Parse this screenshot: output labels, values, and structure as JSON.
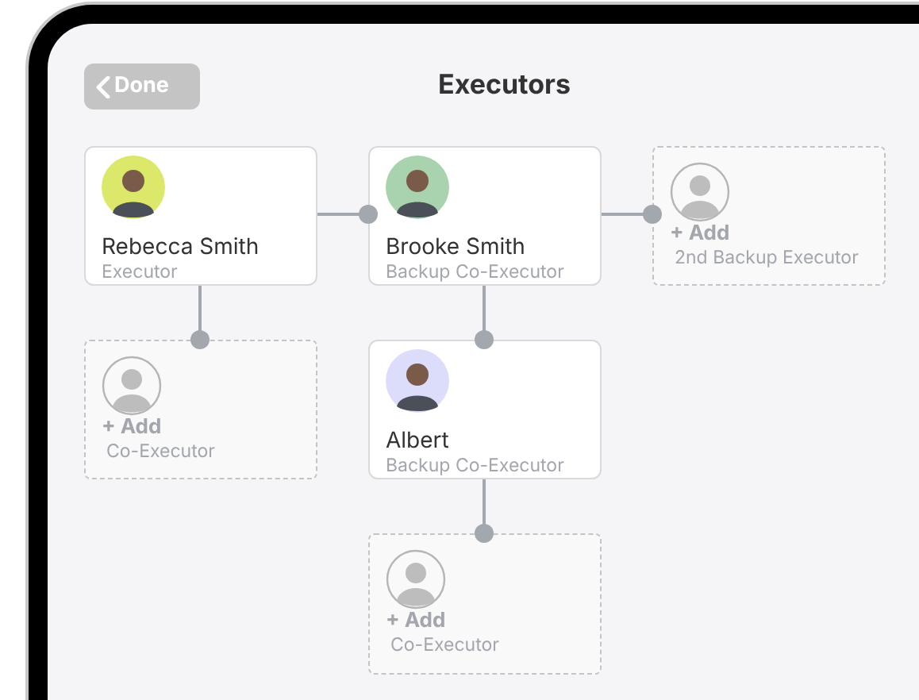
{
  "header": {
    "back_button": "Done",
    "title": "Executors"
  },
  "cards": [
    {
      "kind": "person",
      "name": "Rebecca Smith",
      "role": "Executor",
      "color": "#dbe86a"
    },
    {
      "kind": "person",
      "name": "Brooke Smith",
      "role": "Backup Co-Executor",
      "color": "#a9d3ae"
    },
    {
      "kind": "add",
      "action": "+ Add",
      "role": "2nd Backup Executor"
    },
    {
      "kind": "add",
      "action": "+ Add",
      "role": "Co-Executor"
    },
    {
      "kind": "person",
      "name": "Albert",
      "role": "Backup Co-Executor",
      "color": "#dcdcfb"
    },
    {
      "kind": "add",
      "action": "+ Add",
      "role": "Co-Executor"
    }
  ]
}
